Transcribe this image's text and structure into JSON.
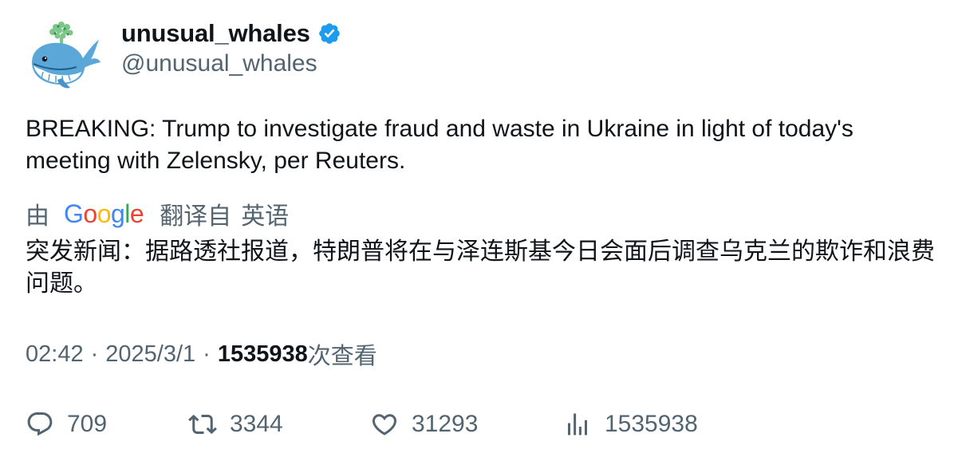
{
  "author": {
    "display_name": "unusual_whales",
    "handle": "@unusual_whales",
    "verified": true,
    "verified_color": "#1d9bf0"
  },
  "tweet": {
    "text": "BREAKING: Trump to investigate fraud and waste in Ukraine in light of today's meeting with Zelensky, per Reuters."
  },
  "translation": {
    "by_label": "由",
    "provider": "Google",
    "from_label": "翻译自",
    "language": "英语",
    "text": "突发新闻：据路透社报道，特朗普将在与泽连斯基今日会面后调查乌克兰的欺诈和浪费问题。"
  },
  "meta": {
    "time": "02:42",
    "date": "2025/3/1",
    "separator": "·",
    "views_count": "1535938",
    "views_label": "次查看"
  },
  "actions": {
    "reply_count": "709",
    "retweet_count": "3344",
    "like_count": "31293",
    "views_count": "1535938"
  },
  "icons": {
    "avatar": "whale-avatar-icon",
    "verified": "verified-badge-icon",
    "reply": "reply-icon",
    "retweet": "retweet-icon",
    "like": "heart-icon",
    "views": "analytics-icon"
  },
  "colors": {
    "text_primary": "#0f1419",
    "text_secondary": "#536471",
    "accent": "#1d9bf0"
  }
}
